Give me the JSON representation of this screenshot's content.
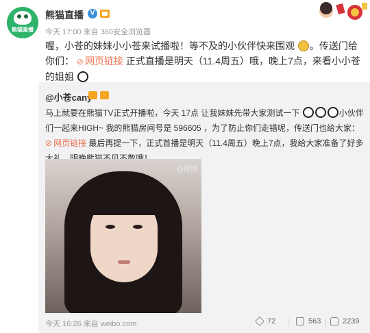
{
  "post": {
    "username": "熊猫直播",
    "verified_mark": "V",
    "avatar_logo_text": "熊猫直播",
    "meta_line": "今天 17:00 来自 360安全浏览器",
    "text_part1": "喔，小苍的妹妹小小苍来试播啦！等不及的小伙伴快来围观",
    "text_part2": "。传送门给你们：",
    "link_icon": "⊘",
    "link_text": "网页链接",
    "text_part3": " 正式直播是明天（11.4周五）哦，晚上7点，来看小小苍的姐姐"
  },
  "repost": {
    "username": "@小苍cany",
    "text_part1": "马上就要在熊猫TV正式开播啦，今天 17点 让我妹妹先带大家测试一下",
    "text_part2": "小伙伴们一起来HIGH~ 我的熊猫房间号是 596605 ，为了防止你们走错呢，传送门也给大家：",
    "link_icon": "⊘",
    "link_text": "网页链接",
    "text_part3": " 最后再提一下，正式首播是明天（11.4周五）晚上7点，我给大家准备了好多大礼，明晚熊猫不见不散哦！",
    "video_watermark": "@微博",
    "footer_time": "今天 16:26 来自 weibo.com",
    "shares": "72",
    "comments": "563",
    "likes": "2239",
    "icons": {
      "share": "share-icon",
      "comment": "comment-icon",
      "like": "like-icon"
    }
  },
  "colors": {
    "link": "#eb7350",
    "repost_bg": "#f2f2f5",
    "brand_green": "#2db36a"
  }
}
